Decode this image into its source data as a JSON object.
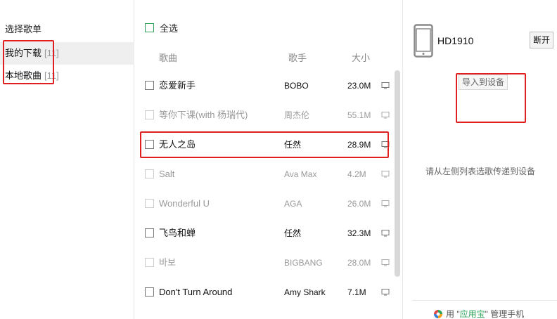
{
  "sidebar": {
    "heading": "选择歌单",
    "items": [
      {
        "label": "我的下载",
        "count": "[11]",
        "active": true
      },
      {
        "label": "本地歌曲",
        "count": "[11]",
        "active": false
      }
    ]
  },
  "song_list": {
    "select_all_label": "全选",
    "columns": {
      "song": "歌曲",
      "artist": "歌手",
      "size": "大小"
    },
    "rows": [
      {
        "name": "恋爱新手",
        "artist": "BOBO",
        "size": "23.0M",
        "enabled": true
      },
      {
        "name": "等你下课(with 杨瑞代)",
        "artist": "周杰伦",
        "size": "55.1M",
        "enabled": false
      },
      {
        "name": "无人之岛",
        "artist": "任然",
        "size": "28.9M",
        "enabled": true
      },
      {
        "name": "Salt",
        "artist": "Ava Max",
        "size": "4.2M",
        "enabled": false
      },
      {
        "name": "Wonderful U",
        "artist": "AGA",
        "size": "26.0M",
        "enabled": false
      },
      {
        "name": "飞鸟和蝉",
        "artist": "任然",
        "size": "32.3M",
        "enabled": true
      },
      {
        "name": "바보",
        "artist": "BIGBANG",
        "size": "28.0M",
        "enabled": false
      },
      {
        "name": "Don't Turn Around",
        "artist": "Amy Shark",
        "size": "7.1M",
        "enabled": true
      }
    ]
  },
  "device": {
    "name": "HD1910",
    "disconnect_label": "断开",
    "import_label": "导入到设备",
    "hint": "请从左侧列表选歌传递到设备"
  },
  "footer": {
    "prefix": "用 \"",
    "brand": "应用宝",
    "suffix": "\" 管理手机"
  },
  "colors": {
    "accent_green": "#2fa35b",
    "annotation_red": "#e02020"
  }
}
